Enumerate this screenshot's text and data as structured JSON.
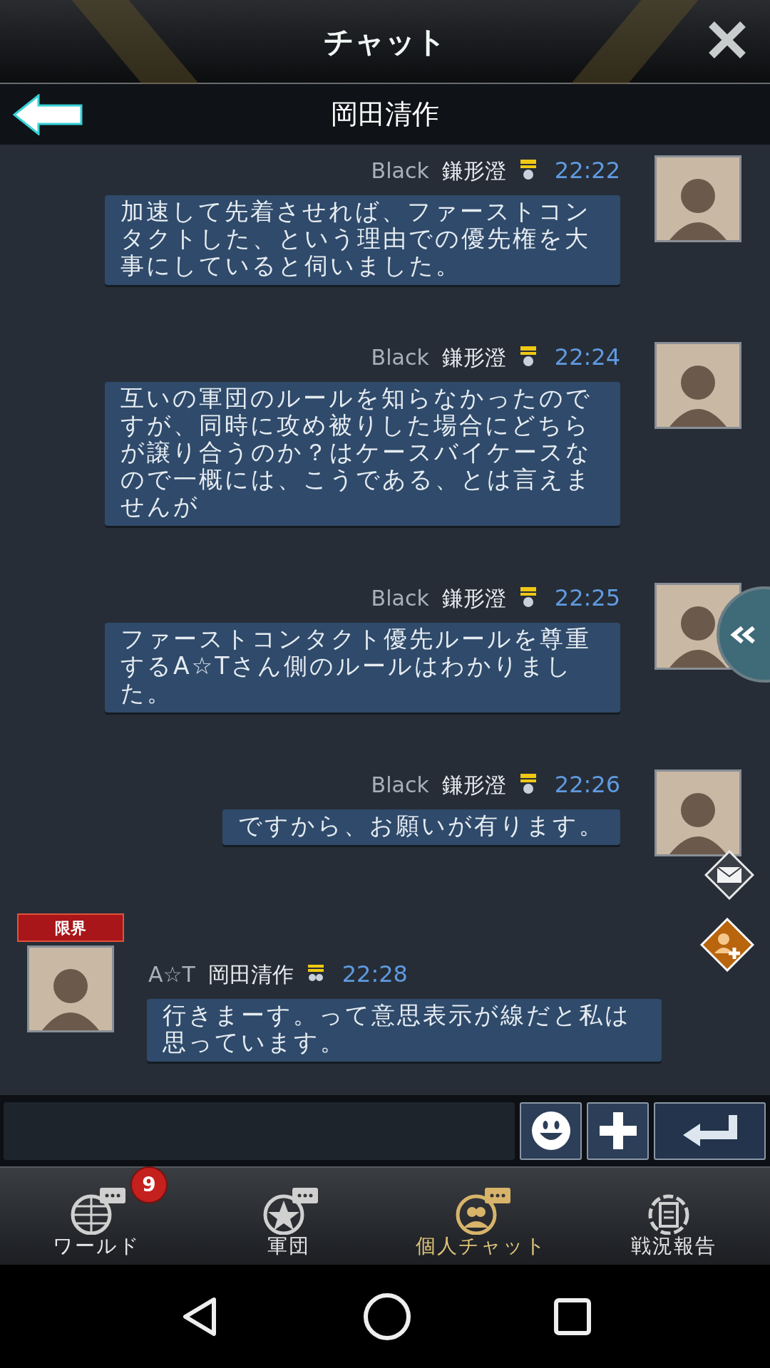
{
  "window": {
    "title": "チャット"
  },
  "conversation": {
    "title": "岡田清作"
  },
  "messages": [
    {
      "kind": "outgoing",
      "tag": "Black",
      "name": "鎌形澄",
      "time": "22:22",
      "text": "加速して先着させれば、ファーストコンタクトした、という理由での優先権を大事にしていると伺いました。"
    },
    {
      "kind": "outgoing",
      "tag": "Black",
      "name": "鎌形澄",
      "time": "22:24",
      "text": "互いの軍団のルールを知らなかったのですが、同時に攻め被りした場合にどちらが譲り合うのか？はケースバイケースなので一概には、こうである、とは言えませんが"
    },
    {
      "kind": "outgoing",
      "tag": "Black",
      "name": "鎌形澄",
      "time": "22:25",
      "text": "ファーストコンタクト優先ルールを尊重するA☆Tさん側のルールはわかりました。"
    },
    {
      "kind": "outgoing",
      "tag": "Black",
      "name": "鎌形澄",
      "time": "22:26",
      "text": "ですから、お願いが有ります。"
    },
    {
      "kind": "incoming",
      "tag": "A☆T",
      "name": "岡田清作",
      "time": "22:28",
      "frame_label": "限界",
      "text": "行きまーす。って意思表示が線だと私は思っています。"
    }
  ],
  "tabs": [
    {
      "kind": "world",
      "label": "ワールド",
      "selected": false,
      "badge": "9"
    },
    {
      "kind": "legion",
      "label": "軍団",
      "selected": false
    },
    {
      "kind": "private",
      "label": "個人チャット",
      "selected": true
    },
    {
      "kind": "report",
      "label": "戦況報告",
      "selected": false
    }
  ]
}
